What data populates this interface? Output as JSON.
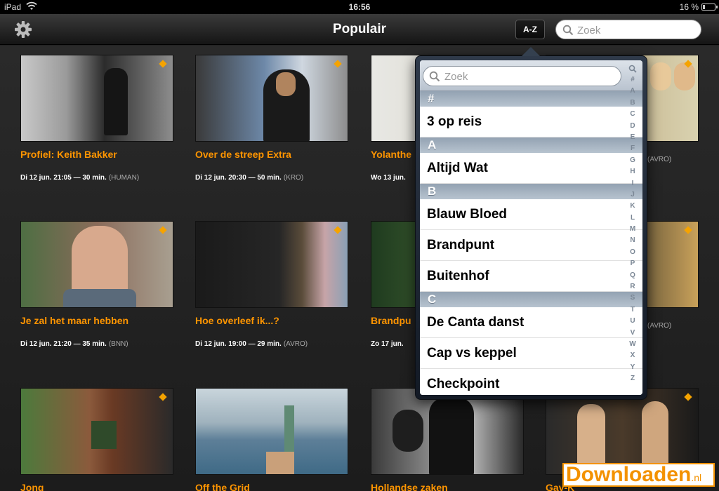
{
  "status_bar": {
    "device": "iPad",
    "time": "16:56",
    "battery": "16 %",
    "battery_level": 0.16
  },
  "nav": {
    "title": "Populair",
    "az_label": "A-Z",
    "search_placeholder": "Zoek"
  },
  "tiles": [
    {
      "title": "Profiel: Keith Bakker",
      "when": "Di 12 jun. 21:05 — 30 min.",
      "network": "(HUMAN)"
    },
    {
      "title": "Over de streep Extra",
      "when": "Di 12 jun. 20:30 — 50 min.",
      "network": "(KRO)"
    },
    {
      "title": "Yolanthe",
      "when": "Wo 13 jun.",
      "network": ""
    },
    {
      "title": "",
      "when": "",
      "network": "(AVRO)"
    },
    {
      "title": "Je zal het maar hebben",
      "when": "Di 12 jun. 21:20 — 35 min.",
      "network": "(BNN)"
    },
    {
      "title": "Hoe overleef ik...?",
      "when": "Di 12 jun. 19:00 — 29 min.",
      "network": "(AVRO)"
    },
    {
      "title": "Brandpu",
      "when": "Zo 17 jun.",
      "network": ""
    },
    {
      "title": "",
      "when": "",
      "network": "(AVRO)"
    },
    {
      "title": "Jong",
      "when": "",
      "network": ""
    },
    {
      "title": "Off the Grid",
      "when": "",
      "network": ""
    },
    {
      "title": "Hollandse zaken",
      "when": "",
      "network": ""
    },
    {
      "title": "Gay-K",
      "when": "",
      "network": ""
    }
  ],
  "popover": {
    "search_placeholder": "Zoek",
    "sections": [
      {
        "header": "#",
        "rows": [
          "3 op reis"
        ]
      },
      {
        "header": "A",
        "rows": [
          "Altijd Wat"
        ]
      },
      {
        "header": "B",
        "rows": [
          "Blauw Bloed",
          "Brandpunt",
          "Buitenhof"
        ]
      },
      {
        "header": "C",
        "rows": [
          "De Canta danst",
          "Cap vs keppel",
          "Checkpoint"
        ]
      }
    ],
    "index": [
      "#",
      "A",
      "B",
      "C",
      "D",
      "E",
      "F",
      "G",
      "H",
      "I",
      "J",
      "K",
      "L",
      "M",
      "N",
      "O",
      "P",
      "Q",
      "R",
      "S",
      "T",
      "U",
      "V",
      "W",
      "X",
      "Y",
      "Z"
    ]
  },
  "watermark": {
    "text": "Downloaden",
    "suffix": ".nl"
  },
  "colors": {
    "accent": "#ff9500",
    "nav_bg": "#1f1f1f",
    "section_header": "#a7b4c2",
    "watermark": "#f39200"
  }
}
